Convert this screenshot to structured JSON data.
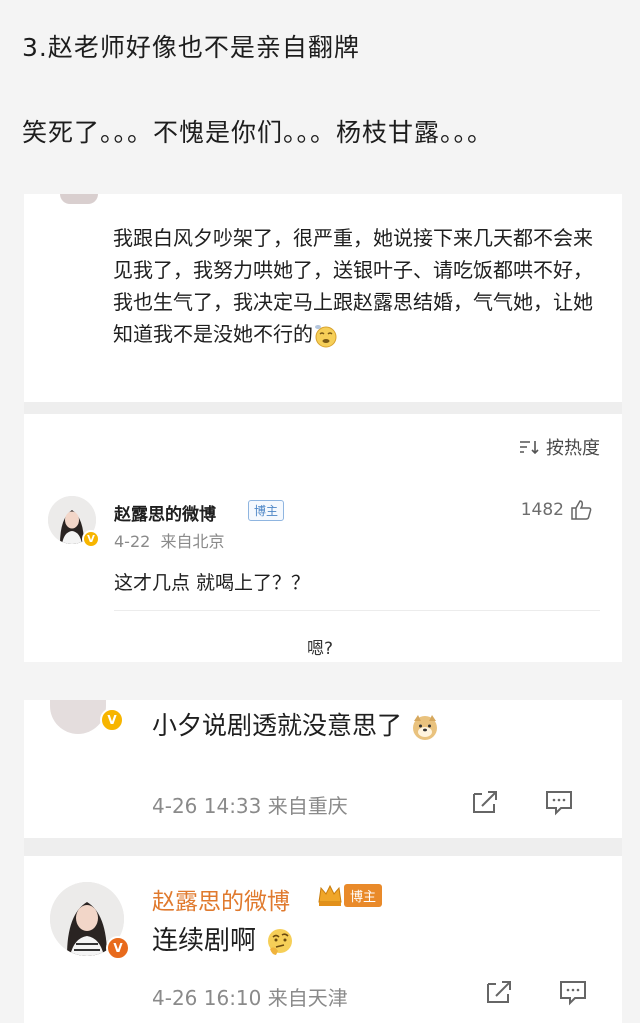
{
  "captions": {
    "line1": "3.赵老师好像也不是亲自翻牌",
    "line2": "笑死了。。。不愧是你们。。。杨枝甘露。。。"
  },
  "post": {
    "text": "我跟白风夕吵架了，很严重，她说接下来几天都不会来见我了，我努力哄她了，送银叶子、请吃饭都哄不好，我也生气了，我决定马上跟赵露思结婚，气气她，让她知道我不是没她不行的"
  },
  "sort": {
    "label": "按热度"
  },
  "comment1": {
    "username": "赵露思的微博",
    "tag": "博主",
    "date": "4-22",
    "location": "来自北京",
    "likes": "1482",
    "text": "这才几点 就喝上了？？"
  },
  "reply_hint": "嗯?",
  "comment2": {
    "text": "小夕说剧透就没意思了",
    "timestamp": "4-26 14:33",
    "location": "来自重庆"
  },
  "comment3": {
    "username": "赵露思的微博",
    "tag": "博主",
    "text": "连续剧啊",
    "timestamp": "4-26 16:10",
    "location": "来自天津"
  },
  "colors": {
    "host_tag": "#4d86c6",
    "verified": "#f7b500",
    "meta": "#8a8a8a"
  }
}
